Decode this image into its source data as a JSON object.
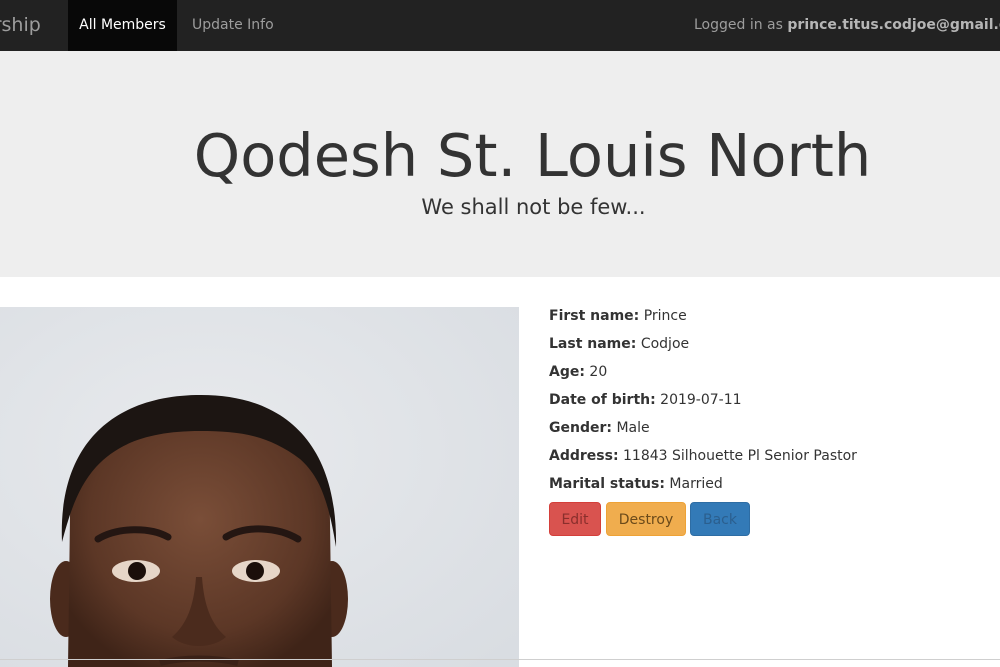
{
  "navbar": {
    "brand": "ership",
    "items": [
      {
        "label": "All Members",
        "active": true
      },
      {
        "label": "Update Info",
        "active": false
      }
    ],
    "logged_in_prefix": "Logged in as",
    "user_email": "prince.titus.codjoe@gmail.com"
  },
  "jumbotron": {
    "title": "Qodesh St. Louis North",
    "subtitle": "We shall not be few..."
  },
  "member": {
    "fields": [
      {
        "label": "First name:",
        "value": "Prince"
      },
      {
        "label": "Last name:",
        "value": "Codjoe"
      },
      {
        "label": "Age:",
        "value": "20"
      },
      {
        "label": "Date of birth:",
        "value": "2019-07-11"
      },
      {
        "label": "Gender:",
        "value": "Male"
      },
      {
        "label": "Address:",
        "value": "11843 Silhouette Pl Senior Pastor"
      },
      {
        "label": "Marital status:",
        "value": "Married"
      }
    ],
    "photo_icon": "member-portrait"
  },
  "actions": {
    "edit_label": "Edit",
    "destroy_label": "Destroy",
    "back_label": "Back"
  },
  "colors": {
    "navbar_bg": "#222222",
    "jumbotron_bg": "#eeeeee",
    "edit": "#d9534f",
    "destroy": "#f0ad4e",
    "back": "#337ab7"
  }
}
